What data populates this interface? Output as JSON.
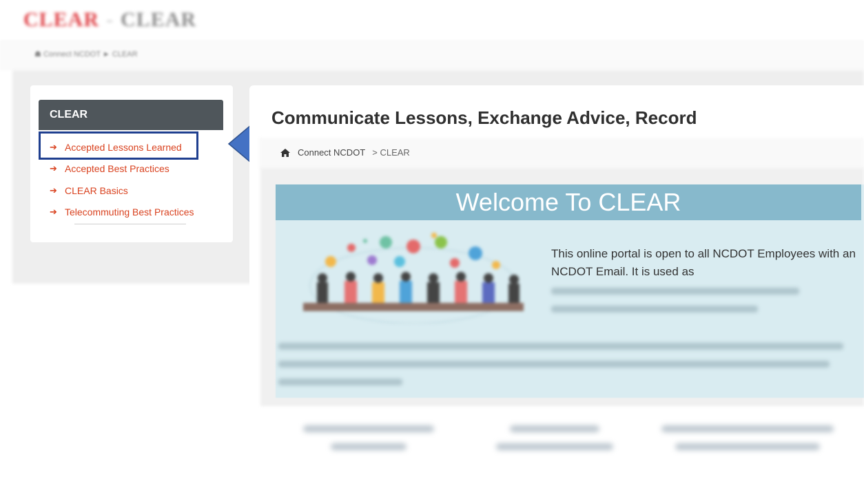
{
  "site_header": {
    "title_left": "CLEAR",
    "title_sep": "-",
    "title_right": "CLEAR",
    "breadcrumb": "Connect NCDOT ► CLEAR"
  },
  "sidebar": {
    "header": "CLEAR",
    "items": [
      {
        "label": "Accepted Lessons Learned"
      },
      {
        "label": "Accepted Best Practices"
      },
      {
        "label": "CLEAR Basics"
      },
      {
        "label": "Telecommuting Best Practices"
      }
    ]
  },
  "main": {
    "title": "Communicate Lessons, Exchange Advice, Record",
    "breadcrumb": {
      "home": "Connect NCDOT",
      "sep": ">",
      "current": "CLEAR"
    },
    "welcome": {
      "heading": "Welcome To CLEAR",
      "text": "This online portal is open to all NCDOT Employees with an NCDOT Email. It is used as"
    }
  },
  "colors": {
    "accent_link": "#d9411e",
    "sidebar_header_bg": "#4f565b",
    "welcome_header_bg": "#87b9cc",
    "welcome_panel_bg": "#d9ecf1",
    "callout": "#1f3f8f",
    "callout_arrow": "#4472c4"
  },
  "icons": {
    "sidebar_item": "arrow-right-icon",
    "breadcrumb_home": "home-icon",
    "callout": "left-arrow-callout"
  }
}
